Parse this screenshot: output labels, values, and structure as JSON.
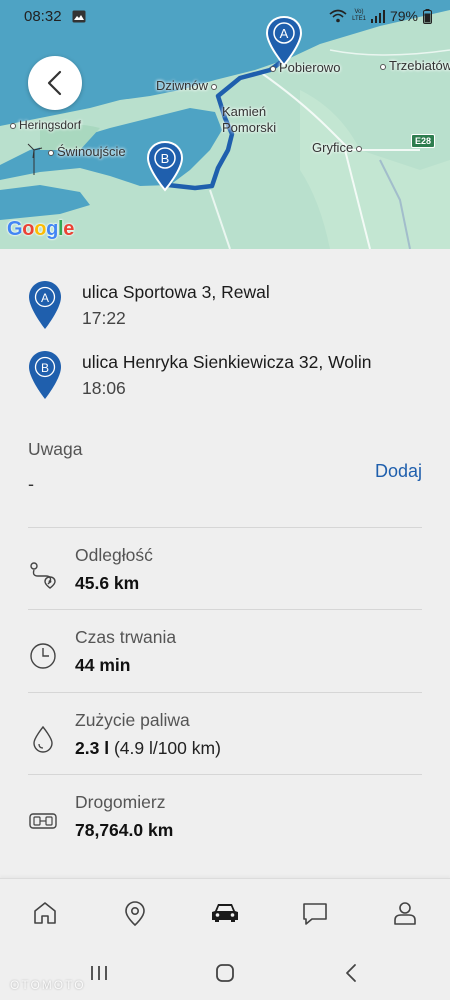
{
  "status_bar": {
    "time": "08:32",
    "net_top": "Vo)",
    "net_bottom": "LTE1",
    "battery": "79%"
  },
  "map": {
    "labels": {
      "pobierowo": "Pobierowo",
      "trzebiatow": "Trzebiatów",
      "dziwnow": "Dziwnów",
      "kamien1": "Kamień",
      "kamien2": "Pomorski",
      "heringsdorf": "Heringsdorf",
      "swinoujscie": "Świnoujście",
      "gryfice": "Gryfice",
      "road": "E28"
    },
    "pin_a": "A",
    "pin_b": "B",
    "attribution": "Google",
    "colors": {
      "land": "#b9e0cd",
      "water": "#4ea3c4",
      "route": "#1f5fad"
    }
  },
  "trip": {
    "start": {
      "marker": "A",
      "address": "ulica Sportowa 3, Rewal",
      "time": "17:22"
    },
    "end": {
      "marker": "B",
      "address": "ulica Henryka Sienkiewicza 32, Wolin",
      "time": "18:06"
    },
    "note": {
      "label": "Uwaga",
      "value": "-",
      "add_label": "Dodaj"
    },
    "stats": {
      "distance": {
        "label": "Odległość",
        "value": "45.6 km",
        "icon": "route-icon"
      },
      "duration": {
        "label": "Czas trwania",
        "value": "44 min",
        "icon": "clock-icon"
      },
      "fuel": {
        "label": "Zużycie paliwa",
        "value": "2.3 l",
        "extra": "(4.9 l/100 km)",
        "icon": "fuel-drop-icon"
      },
      "odometer": {
        "label": "Drogomierz",
        "value": "78,764.0 km",
        "icon": "odometer-icon"
      }
    }
  },
  "bottom_nav": {
    "items": [
      "home-icon",
      "location-pin-icon",
      "car-icon",
      "chat-icon",
      "profile-icon"
    ],
    "active": "car-icon"
  },
  "watermark": "OTOMOTO"
}
